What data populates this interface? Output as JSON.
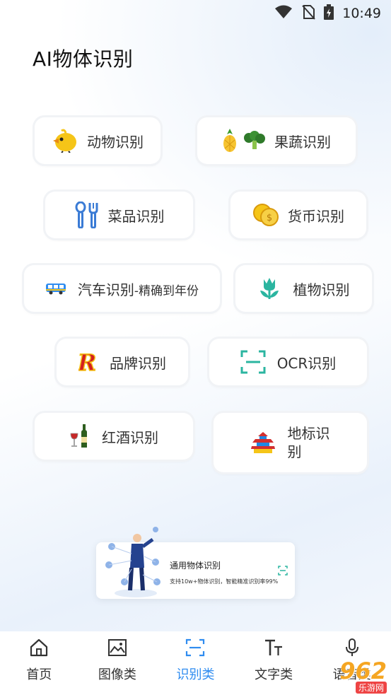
{
  "status_bar": {
    "time": "10:49"
  },
  "page": {
    "title": "AI物体识别"
  },
  "chips": {
    "animal": "动物识别",
    "fruit": "果蔬识别",
    "dish": "菜品识别",
    "currency": "货币识别",
    "car": "汽车识别",
    "car_sub": "-精确到年份",
    "plant": "植物识别",
    "brand": "品牌识别",
    "ocr": "OCR识别",
    "wine": "红酒识别",
    "landmark_line1": "地标识",
    "landmark_line2": "别"
  },
  "card": {
    "title": "通用物体识别",
    "desc": "支持10w+物体识别，智能精准识别率99%"
  },
  "nav": {
    "home": "首页",
    "image": "图像类",
    "recognize": "识别类",
    "text": "文字类",
    "voice": "语音类"
  },
  "watermark": {
    "main": "962",
    "sub": "乐游网"
  },
  "colors": {
    "accent": "#2f8cf0",
    "ocr_green": "#2bb5a0"
  }
}
